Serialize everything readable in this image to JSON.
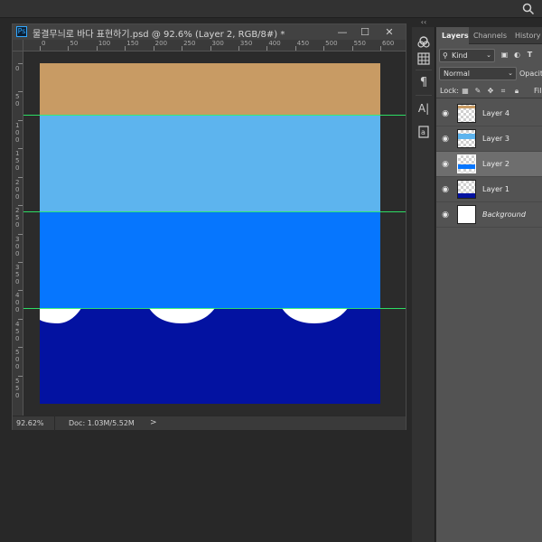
{
  "document": {
    "title": "물결무늬로 바다 표현하기.psd @ 92.6% (Layer 2, RGB/8#) *",
    "app_badge": "Ps",
    "window_buttons": {
      "minimize": "—",
      "restore": "☐",
      "close": "✕"
    }
  },
  "rulers": {
    "horizontal": [
      "0",
      "50",
      "100",
      "150",
      "200",
      "250",
      "300",
      "350",
      "400",
      "450",
      "500",
      "550",
      "600"
    ],
    "vertical": [
      "0",
      "50",
      "100",
      "150",
      "200",
      "250",
      "300",
      "350",
      "400",
      "450",
      "500",
      "550"
    ]
  },
  "canvas": {
    "colors": {
      "sand": "#c89b64",
      "light_water": "#5db4ee",
      "mid_water": "#0676fe",
      "deep_water": "#0312a1",
      "foam": "#ffffff",
      "guide": "#2df06a"
    }
  },
  "status": {
    "zoom": "92.62%",
    "doc_size": "Doc: 1.03M/5.52M",
    "arrow": ">"
  },
  "toolstrip": {
    "collapse": "‹‹",
    "icons": [
      "channel-mixer-icon",
      "grid-icon",
      "paragraph-icon",
      "character-icon",
      "glyphs-icon"
    ]
  },
  "panel": {
    "tabs": [
      {
        "label": "Layers",
        "active": true
      },
      {
        "label": "Channels",
        "active": false
      },
      {
        "label": "History",
        "active": false
      }
    ],
    "filter": {
      "kind": "Kind"
    },
    "blend_mode": "Normal",
    "opacity_label": "Opacity",
    "lock_label": "Lock:",
    "fill_label": "Fil",
    "layers": [
      {
        "name": "Layer 4",
        "selected": false,
        "italic": false
      },
      {
        "name": "Layer 3",
        "selected": false,
        "italic": false
      },
      {
        "name": "Layer 2",
        "selected": true,
        "italic": false
      },
      {
        "name": "Layer 1",
        "selected": false,
        "italic": false
      },
      {
        "name": "Background",
        "selected": false,
        "italic": true
      }
    ]
  }
}
